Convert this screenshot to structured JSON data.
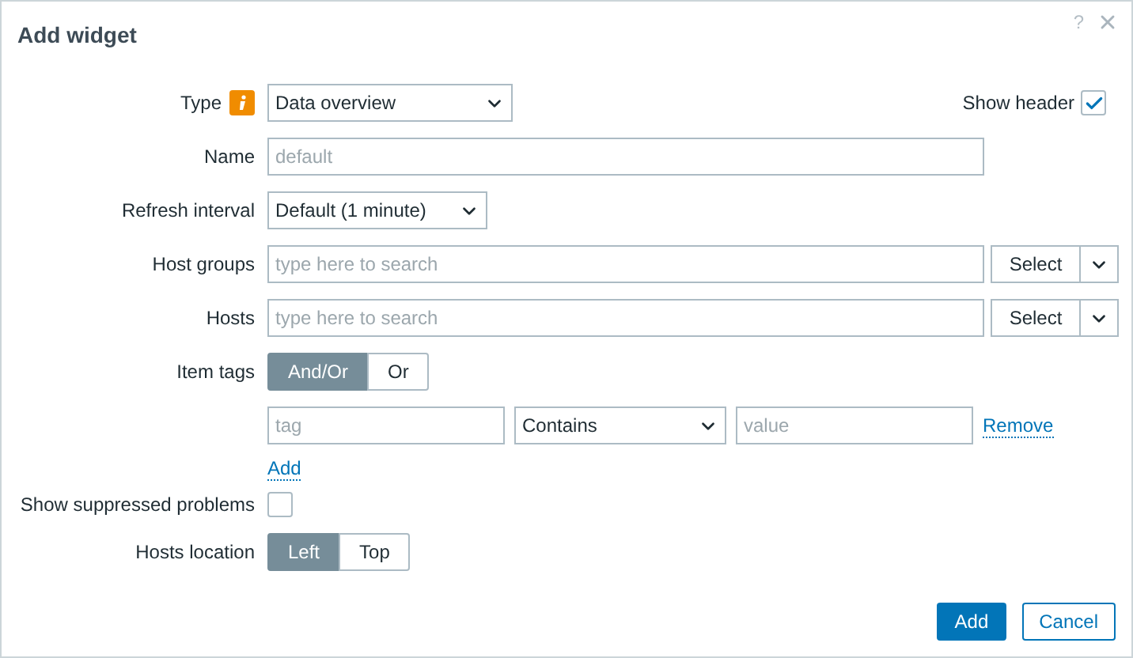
{
  "dialog": {
    "title": "Add widget",
    "help": "?"
  },
  "header_toggle": {
    "label": "Show header",
    "checked": true
  },
  "fields": [
    {
      "kind": "wide_select",
      "label": "Type",
      "info": true,
      "value": "Data overview"
    },
    {
      "kind": "text",
      "label": "Name",
      "placeholder": "default"
    },
    {
      "kind": "select",
      "label": "Refresh interval",
      "value": "Default (1 minute)"
    },
    {
      "kind": "multiselect",
      "label": "Host groups",
      "placeholder": "type here to search",
      "button": "Select"
    },
    {
      "kind": "multiselect",
      "label": "Hosts",
      "placeholder": "type here to search",
      "button": "Select"
    },
    {
      "kind": "segmented",
      "label": "Item tags",
      "options": [
        {
          "label": "And/Or",
          "selected": true
        },
        {
          "label": "Or",
          "selected": false
        }
      ]
    },
    {
      "kind": "tags",
      "tag_placeholder": "tag",
      "operator": "Contains",
      "value_placeholder": "value",
      "remove": "Remove",
      "add": "Add"
    },
    {
      "kind": "checkbox",
      "label": "Show suppressed problems",
      "checked": false
    },
    {
      "kind": "segmented",
      "label": "Hosts location",
      "options": [
        {
          "label": "Left",
          "selected": true
        },
        {
          "label": "Top",
          "selected": false
        }
      ]
    }
  ],
  "buttons": [
    {
      "label": "Add",
      "primary": true
    },
    {
      "label": "Cancel",
      "primary": false
    }
  ]
}
